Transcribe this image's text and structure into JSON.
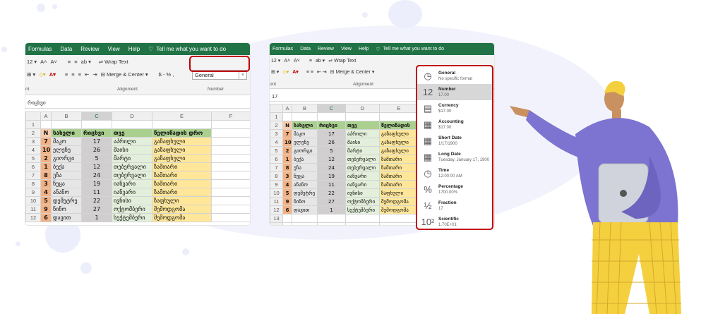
{
  "colors": {
    "excel_green": "#217346",
    "highlight_red": "#c00000",
    "header_green": "#a9d08e",
    "orange": "#f4b183",
    "yellow": "#ffe699"
  },
  "left": {
    "menu": [
      "Formulas",
      "Data",
      "Review",
      "View",
      "Help"
    ],
    "tell_me": "Tell me what you want to do",
    "font_size": "12",
    "wrap_text": "Wrap Text",
    "merge_center": "Merge & Center",
    "number_format": "General",
    "number_buttons": "$  -  %  ,",
    "group_font": "nt",
    "group_alignment": "Alignment",
    "group_number": "Number",
    "formula_bar": "რიცხვი",
    "col_headers": [
      "",
      "A",
      "B",
      "C",
      "D",
      "E",
      "F"
    ],
    "rows": [
      {
        "r": "1",
        "n": "",
        "name": "",
        "qty": "",
        "city": "",
        "date": ""
      },
      {
        "r": "2",
        "n": "N",
        "name": "სახელი",
        "qty": "რიცხვი",
        "city": "თვე",
        "date": "წელიწადის დრო"
      },
      {
        "r": "3",
        "n": "7",
        "name": "მაკო",
        "qty": "17",
        "city": "აპრილი",
        "date": "გაზაფხული"
      },
      {
        "r": "4",
        "n": "10",
        "name": "ელენე",
        "qty": "26",
        "city": "მაისი",
        "date": "გაზაფხული"
      },
      {
        "r": "5",
        "n": "2",
        "name": "გიორგი",
        "qty": "5",
        "city": "მარტი",
        "date": "გაზაფხული"
      },
      {
        "r": "6",
        "n": "1",
        "name": "ბექა",
        "qty": "12",
        "city": "თებერვალი",
        "date": "ზამთარი"
      },
      {
        "r": "7",
        "n": "8",
        "name": "უჩა",
        "qty": "24",
        "city": "თებერვალი",
        "date": "ზამთარი"
      },
      {
        "r": "8",
        "n": "3",
        "name": "ნუცა",
        "qty": "19",
        "city": "იანვარი",
        "date": "ზამთარი"
      },
      {
        "r": "9",
        "n": "4",
        "name": "ანანო",
        "qty": "11",
        "city": "იანვარი",
        "date": "ზამთარი"
      },
      {
        "r": "10",
        "n": "5",
        "name": "დემეტრე",
        "qty": "22",
        "city": "ივნისი",
        "date": "ზაფხული"
      },
      {
        "r": "11",
        "n": "9",
        "name": "ნინო",
        "qty": "27",
        "city": "ოქტომბერი",
        "date": "შემოდგომა"
      },
      {
        "r": "12",
        "n": "6",
        "name": "დავით",
        "qty": "1",
        "city": "სექტემბერი",
        "date": "შემოდგომა"
      }
    ]
  },
  "right": {
    "menu": [
      "Formulas",
      "Data",
      "Review",
      "View",
      "Help"
    ],
    "tell_me": "Tell me what you want to do",
    "font_size": "12",
    "wrap_text": "Wrap Text",
    "merge_center": "Merge & Center",
    "group_font": "ont",
    "group_alignment": "Alignment",
    "formula_bar": "17",
    "col_headers": [
      "",
      "A",
      "B",
      "C",
      "D",
      "E"
    ],
    "rows": [
      {
        "r": "1",
        "n": "",
        "name": "",
        "qty": "",
        "city": "",
        "date": ""
      },
      {
        "r": "2",
        "n": "N",
        "name": "სახელი",
        "qty": "რიცხვი",
        "city": "თვე",
        "date": "წელიწადის"
      },
      {
        "r": "3",
        "n": "7",
        "name": "მაკო",
        "qty": "17",
        "city": "აპრილი",
        "date": "გაზაფხული"
      },
      {
        "r": "4",
        "n": "10",
        "name": "ელენე",
        "qty": "26",
        "city": "მაისი",
        "date": "გაზაფხული"
      },
      {
        "r": "5",
        "n": "2",
        "name": "გიორგი",
        "qty": "5",
        "city": "მარტი",
        "date": "გაზაფხული"
      },
      {
        "r": "6",
        "n": "1",
        "name": "ბექა",
        "qty": "12",
        "city": "თებერვალი",
        "date": "ზამთარი"
      },
      {
        "r": "7",
        "n": "8",
        "name": "უჩა",
        "qty": "24",
        "city": "თებერვალი",
        "date": "ზამთარი"
      },
      {
        "r": "8",
        "n": "3",
        "name": "ნუცა",
        "qty": "19",
        "city": "იანვარი",
        "date": "ზამთარი"
      },
      {
        "r": "9",
        "n": "4",
        "name": "ანანო",
        "qty": "11",
        "city": "იანვარი",
        "date": "ზამთარი"
      },
      {
        "r": "10",
        "n": "5",
        "name": "დემეტრე",
        "qty": "22",
        "city": "ივნისი",
        "date": "ზაფხული"
      },
      {
        "r": "11",
        "n": "9",
        "name": "ნინო",
        "qty": "27",
        "city": "ოქტომბერი",
        "date": "შემოდგომა"
      },
      {
        "r": "12",
        "n": "6",
        "name": "დავით",
        "qty": "1",
        "city": "სექტემბერი",
        "date": "შემოდგომა"
      },
      {
        "r": "13",
        "n": "",
        "name": "",
        "qty": "",
        "city": "",
        "date": ""
      },
      {
        "r": "14",
        "n": "",
        "name": "",
        "qty": "",
        "city": "",
        "date": ""
      },
      {
        "r": "15",
        "n": "",
        "name": "",
        "qty": "",
        "city": "",
        "date": ""
      }
    ],
    "format_options": [
      {
        "icon": "clock-123-icon",
        "glyph": "◷",
        "name": "General",
        "example": "No specific format"
      },
      {
        "icon": "number-12-icon",
        "glyph": "12",
        "name": "Number",
        "example": "17.00"
      },
      {
        "icon": "currency-icon",
        "glyph": "▤",
        "name": "Currency",
        "example": "$17.00"
      },
      {
        "icon": "accounting-icon",
        "glyph": "▦",
        "name": "Accounting",
        "example": " $17.00"
      },
      {
        "icon": "calendar-icon",
        "glyph": "▦",
        "name": "Short Date",
        "example": "1/17/1900"
      },
      {
        "icon": "calendar-long-icon",
        "glyph": "▦",
        "name": "Long Date",
        "example": "Tuesday, January 17, 1900"
      },
      {
        "icon": "clock-icon",
        "glyph": "◷",
        "name": "Time",
        "example": "12:00:00 AM"
      },
      {
        "icon": "percent-icon",
        "glyph": "%",
        "name": "Percentage",
        "example": "1700.00%"
      },
      {
        "icon": "fraction-icon",
        "glyph": "½",
        "name": "Fraction",
        "example": "17"
      },
      {
        "icon": "scientific-icon",
        "glyph": "10²",
        "name": "Scientific",
        "example": "1.70E+01"
      }
    ]
  }
}
